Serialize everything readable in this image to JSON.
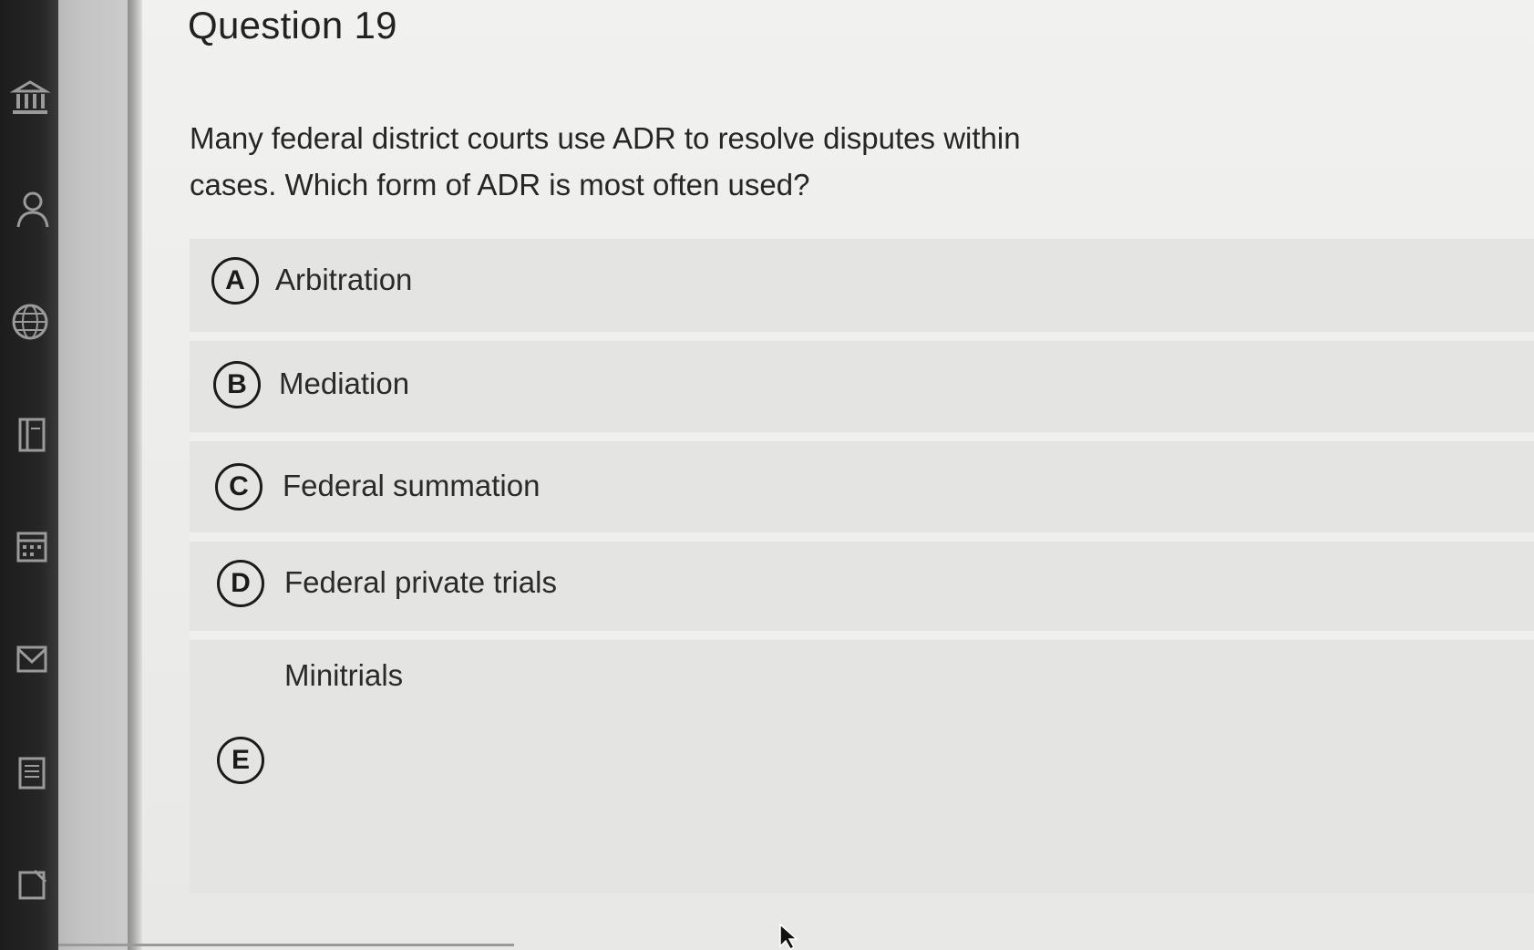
{
  "question": {
    "title": "Question 19",
    "prompt": "Many federal district courts use ADR to resolve disputes within cases. Which form of ADR is most often used?"
  },
  "options": [
    {
      "letter": "A",
      "text": "Arbitration"
    },
    {
      "letter": "B",
      "text": "Mediation"
    },
    {
      "letter": "C",
      "text": "Federal summation"
    },
    {
      "letter": "D",
      "text": "Federal private trials"
    },
    {
      "letter": "E",
      "text": "Minitrials"
    }
  ],
  "sidebar": {
    "icons": [
      "institution-icon",
      "account-icon",
      "globe-icon",
      "courses-icon",
      "calendar-icon",
      "inbox-icon",
      "history-icon",
      "help-icon"
    ]
  },
  "colors": {
    "rail": "#232323",
    "content_bg": "#eeeeec",
    "option_bg": "#e4e4e2",
    "text": "#262626"
  }
}
